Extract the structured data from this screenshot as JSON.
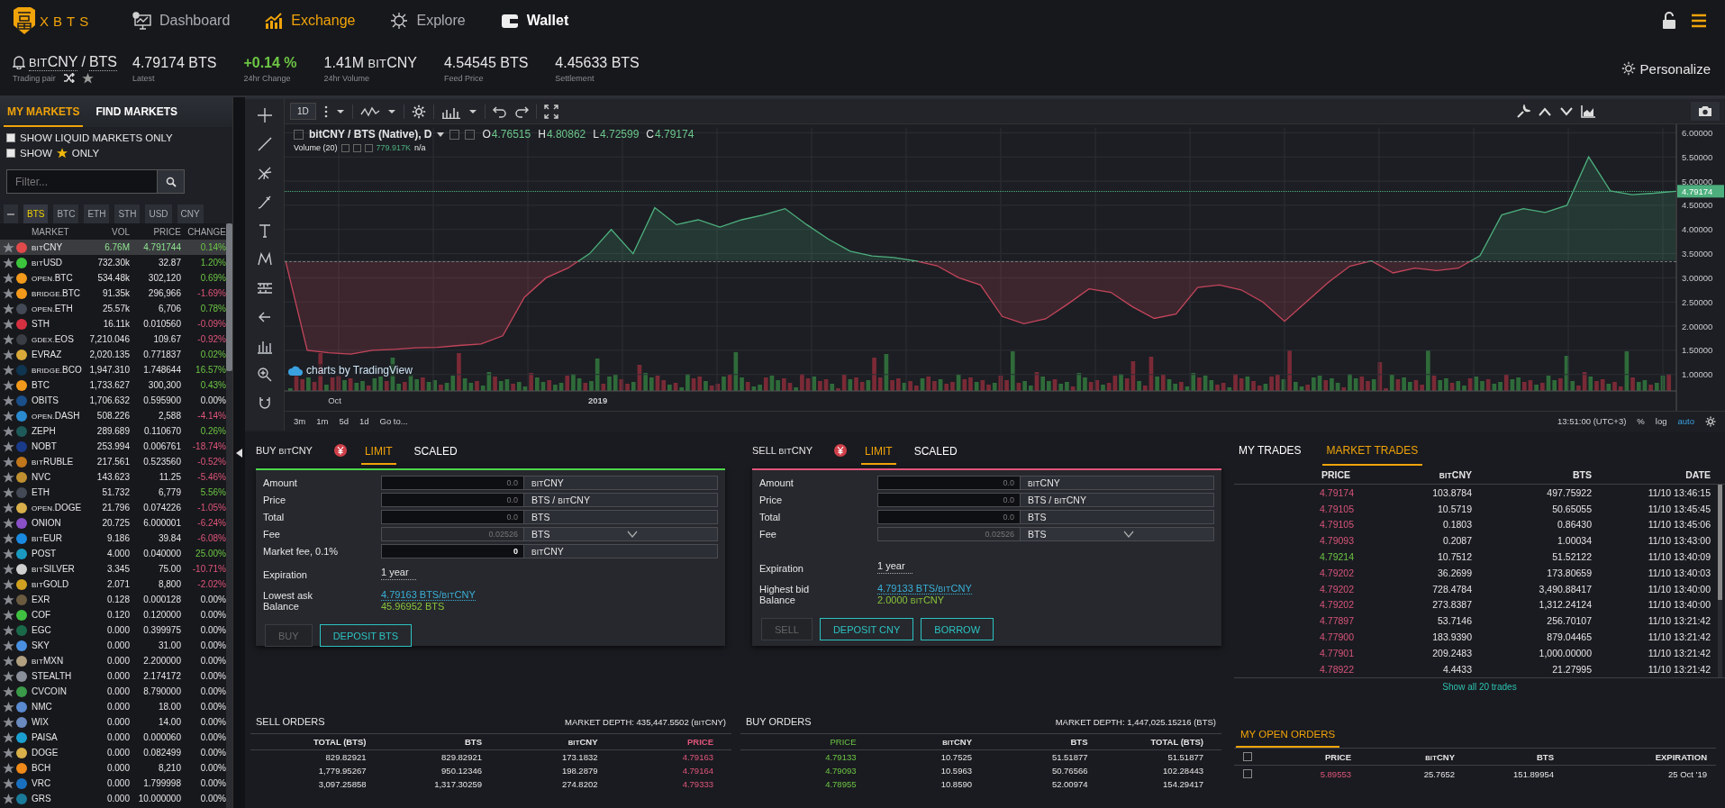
{
  "nav": {
    "logo": "XBTS",
    "items": [
      {
        "label": "Dashboard",
        "selected": false,
        "highlighted": false
      },
      {
        "label": "Exchange",
        "selected": true,
        "highlighted": false
      },
      {
        "label": "Explore",
        "selected": false,
        "highlighted": false
      },
      {
        "label": "Wallet",
        "selected": false,
        "highlighted": true
      }
    ]
  },
  "ticker": {
    "base": {
      "prefix": "BIT",
      "text": "CNY"
    },
    "separator": "/",
    "quote": "BTS",
    "label": "Trading pair",
    "stats": [
      {
        "value": {
          "text": "4.79174 BTS"
        },
        "label": "Latest",
        "up": false,
        "down": false
      },
      {
        "value": {
          "text": "+0.14 %"
        },
        "label": "24hr Change",
        "up": true,
        "down": false
      },
      {
        "value": {
          "lead": "1.41M ",
          "prefix": "BIT",
          "text": "CNY"
        },
        "label": "24hr Volume",
        "up": false,
        "down": false
      },
      {
        "value": {
          "text": "4.54545 BTS"
        },
        "label": "Feed Price",
        "up": false,
        "down": false
      },
      {
        "value": {
          "text": "4.45633 BTS"
        },
        "label": "Settlement",
        "up": false,
        "down": false
      }
    ],
    "personalize": "Personalize"
  },
  "sidebar": {
    "tabs": [
      {
        "label": "MY MARKETS",
        "selected": true
      },
      {
        "label": "FIND MARKETS",
        "selected": false
      }
    ],
    "options": [
      {
        "before": "SHOW LIQUID MARKETS ONLY",
        "checked": false
      },
      {
        "before": "SHOW",
        "after": "ONLY",
        "checked": false
      }
    ],
    "filter": {
      "placeholder": "Filter..."
    },
    "bases": [
      {
        "label": "BTS",
        "selected": true
      },
      {
        "label": "BTC",
        "selected": false
      },
      {
        "label": "ETH",
        "selected": false
      },
      {
        "label": "STH",
        "selected": false
      },
      {
        "label": "USD",
        "selected": false
      },
      {
        "label": "CNY",
        "selected": false
      }
    ],
    "columns": [
      "MARKET",
      "VOL",
      "PRICE",
      "CHANGE"
    ],
    "markets": [
      {
        "prefix": "BIT",
        "name": "CNY",
        "vol": "6.76M",
        "price": "4.791744",
        "change": "0.14%",
        "up": true,
        "down": false,
        "color": "#e04a4a",
        "selected": true
      },
      {
        "prefix": "BIT",
        "name": "USD",
        "vol": "732.30k",
        "price": "32.87",
        "change": "1.20%",
        "up": true,
        "down": false,
        "color": "#3cc43c",
        "selected": false
      },
      {
        "prefix": "OPEN.",
        "name": "BTC",
        "vol": "534.48k",
        "price": "302,120",
        "change": "0.69%",
        "up": true,
        "down": false,
        "color": "#f39a1c",
        "selected": false
      },
      {
        "prefix": "BRIDGE.",
        "name": "BTC",
        "vol": "91.35k",
        "price": "296,966",
        "change": "-1.69%",
        "up": false,
        "down": true,
        "color": "#f39a1c",
        "selected": false
      },
      {
        "prefix": "OPEN.",
        "name": "ETH",
        "vol": "25.57k",
        "price": "6,706",
        "change": "0.78%",
        "up": true,
        "down": false,
        "color": "#444a55",
        "selected": false
      },
      {
        "name": "STH",
        "vol": "16.11k",
        "price": "0.010560",
        "change": "-0.09%",
        "up": false,
        "down": true,
        "color": "#d43040",
        "selected": false
      },
      {
        "prefix": "GDEX.",
        "name": "EOS",
        "vol": "7,210.046",
        "price": "109.67",
        "change": "-0.92%",
        "up": false,
        "down": true,
        "color": "#3a3d44",
        "selected": false
      },
      {
        "name": "EVRAZ",
        "vol": "2,020.135",
        "price": "0.771837",
        "change": "0.02%",
        "up": true,
        "down": false,
        "color": "#d9a93a",
        "selected": false
      },
      {
        "prefix": "BRIDGE.",
        "name": "BCO",
        "vol": "1,947.310",
        "price": "1.748644",
        "change": "16.57%",
        "up": true,
        "down": false,
        "color": "#0f3550",
        "selected": false
      },
      {
        "name": "BTC",
        "vol": "1,733.627",
        "price": "300,300",
        "change": "0.43%",
        "up": true,
        "down": false,
        "color": "#f39a1c",
        "selected": false
      },
      {
        "name": "OBITS",
        "vol": "1,706.632",
        "price": "0.595900",
        "change": "0.00%",
        "up": false,
        "down": false,
        "color": "#1a4f8a",
        "selected": false
      },
      {
        "prefix": "OPEN.",
        "name": "DASH",
        "vol": "508.226",
        "price": "2,588",
        "change": "-4.14%",
        "up": false,
        "down": true,
        "color": "#2a8ad0",
        "selected": false
      },
      {
        "name": "ZEPH",
        "vol": "289.689",
        "price": "0.110670",
        "change": "0.26%",
        "up": true,
        "down": false,
        "color": "#1e5a5a",
        "selected": false
      },
      {
        "name": "NOBT",
        "vol": "253.994",
        "price": "0.006761",
        "change": "-18.74%",
        "up": false,
        "down": true,
        "color": "#1a3a8a",
        "selected": false
      },
      {
        "prefix": "BIT",
        "name": "RUBLE",
        "vol": "217.561",
        "price": "0.523560",
        "change": "-0.52%",
        "up": false,
        "down": true,
        "color": "#c0761a",
        "selected": false
      },
      {
        "name": "NVC",
        "vol": "143.623",
        "price": "11.25",
        "change": "-5.46%",
        "up": false,
        "down": true,
        "color": "#c09030",
        "selected": false
      },
      {
        "name": "ETH",
        "vol": "51.732",
        "price": "6,779",
        "change": "5.56%",
        "up": true,
        "down": false,
        "color": "#444a55",
        "selected": false
      },
      {
        "prefix": "OPEN.",
        "name": "DOGE",
        "vol": "21.796",
        "price": "0.074226",
        "change": "-1.05%",
        "up": false,
        "down": true,
        "color": "#d9b04a",
        "selected": false
      },
      {
        "name": "ONION",
        "vol": "20.725",
        "price": "6.000001",
        "change": "-6.24%",
        "up": false,
        "down": true,
        "color": "#8a50c8",
        "selected": false
      },
      {
        "prefix": "BIT",
        "name": "EUR",
        "vol": "9.186",
        "price": "39.84",
        "change": "-6.08%",
        "up": false,
        "down": true,
        "color": "#1a8ae0",
        "selected": false
      },
      {
        "name": "POST",
        "vol": "4.000",
        "price": "0.040000",
        "change": "25.00%",
        "up": true,
        "down": false,
        "color": "#1a9ac0",
        "selected": false
      },
      {
        "prefix": "BIT",
        "name": "SILVER",
        "vol": "3.345",
        "price": "75.00",
        "change": "-10.71%",
        "up": false,
        "down": true,
        "color": "#d0d0d0",
        "selected": false
      },
      {
        "prefix": "BIT",
        "name": "GOLD",
        "vol": "2.071",
        "price": "8,800",
        "change": "-2.02%",
        "up": false,
        "down": true,
        "color": "#d0a020",
        "selected": false
      },
      {
        "name": "EXR",
        "vol": "0.128",
        "price": "0.000128",
        "change": "0.00%",
        "up": false,
        "down": false,
        "color": "#6a5a40",
        "selected": false
      },
      {
        "name": "COF",
        "vol": "0.120",
        "price": "0.120000",
        "change": "0.00%",
        "up": false,
        "down": false,
        "color": "#40c040",
        "selected": false
      },
      {
        "name": "EGC",
        "vol": "0.000",
        "price": "0.399975",
        "change": "0.00%",
        "up": false,
        "down": false,
        "color": "#1a6a4a",
        "selected": false
      },
      {
        "name": "SKY",
        "vol": "0.000",
        "price": "31.00",
        "change": "0.00%",
        "up": false,
        "down": false,
        "color": "#4a90e0",
        "selected": false
      },
      {
        "prefix": "BIT",
        "name": "MXN",
        "vol": "0.000",
        "price": "2.200000",
        "change": "0.00%",
        "up": false,
        "down": false,
        "color": "#b0a080",
        "selected": false
      },
      {
        "name": "STEALTH",
        "vol": "0.000",
        "price": "2.174172",
        "change": "0.00%",
        "up": false,
        "down": false,
        "color": "#8a8f9a",
        "selected": false
      },
      {
        "name": "CVCOIN",
        "vol": "0.000",
        "price": "8.790000",
        "change": "0.00%",
        "up": false,
        "down": false,
        "color": "#3a9a4a",
        "selected": false
      },
      {
        "name": "NMC",
        "vol": "0.000",
        "price": "18.00",
        "change": "0.00%",
        "up": false,
        "down": false,
        "color": "#5a8ad0",
        "selected": false
      },
      {
        "name": "WIX",
        "vol": "0.000",
        "price": "14.00",
        "change": "0.00%",
        "up": false,
        "down": false,
        "color": "#6a8ac0",
        "selected": false
      },
      {
        "name": "PAISA",
        "vol": "0.000",
        "price": "0.000060",
        "change": "0.00%",
        "up": false,
        "down": false,
        "color": "#1aa0d0",
        "selected": false
      },
      {
        "name": "DOGE",
        "vol": "0.000",
        "price": "0.082499",
        "change": "0.00%",
        "up": false,
        "down": false,
        "color": "#d9b04a",
        "selected": false
      },
      {
        "name": "BCH",
        "vol": "0.000",
        "price": "8,210",
        "change": "0.00%",
        "up": false,
        "down": false,
        "color": "#f08a1a",
        "selected": false
      },
      {
        "name": "VRC",
        "vol": "0.000",
        "price": "1.799998",
        "change": "0.00%",
        "up": false,
        "down": false,
        "color": "#1a70c0",
        "selected": false
      },
      {
        "name": "GRS",
        "vol": "0.000",
        "price": "10.000000",
        "change": "0.00%",
        "up": false,
        "down": false,
        "color": "#1a7a9a",
        "selected": false
      }
    ]
  },
  "chart": {
    "interval": "1D",
    "title_suffix": " (Native), D",
    "time_labels": [
      "Oct",
      "2019"
    ],
    "ohlc": [
      {
        "key": "O",
        "value": "4.76515"
      },
      {
        "key": "H",
        "value": "4.80862"
      },
      {
        "key": "L",
        "value": "4.72599"
      },
      {
        "key": "C",
        "value": "4.79174"
      }
    ],
    "volume_label": "Volume (20)",
    "volume_value": "779.917K",
    "volume_extra": "n/a",
    "credit": "charts by TradingView",
    "ranges": [
      "3m",
      "1m",
      "5d",
      "1d"
    ],
    "goto": "Go to...",
    "time": "13:51:00 (UTC+3)",
    "scale_options": [
      {
        "label": "%",
        "selected": false
      },
      {
        "label": "log",
        "selected": false
      },
      {
        "label": "auto",
        "selected": true
      }
    ],
    "chart_data": {
      "type": "area",
      "grid": true,
      "ylim": [
        0.66,
        6.1
      ],
      "series": [
        {
          "name": "bitCNY / BTS",
          "color": "#4caf7d",
          "values": [
            3.35,
            1.5,
            1.45,
            1.42,
            1.5,
            1.52,
            1.55,
            1.56,
            1.6,
            1.63,
            1.8,
            2.6,
            3.0,
            3.2,
            3.5,
            4.0,
            3.5,
            4.45,
            4.1,
            4.2,
            4.05,
            4.2,
            4.3,
            4.43,
            4.1,
            3.8,
            3.55,
            3.45,
            3.42,
            3.35,
            3.25,
            3.0,
            2.85,
            2.2,
            2.05,
            2.15,
            2.45,
            2.77,
            2.7,
            2.4,
            2.16,
            2.25,
            2.8,
            2.85,
            2.75,
            2.5,
            2.1,
            2.5,
            2.9,
            3.24,
            3.35,
            3.1,
            3.2,
            3.15,
            3.2,
            3.46,
            4.3,
            4.43,
            4.35,
            4.5,
            5.5,
            4.8,
            4.72,
            4.75,
            4.79
          ]
        }
      ],
      "yticks": [
        {
          "value": 1,
          "label": "1.00000"
        },
        {
          "value": 1.5,
          "label": "1.50000"
        },
        {
          "value": 2,
          "label": "2.00000"
        },
        {
          "value": 2.5,
          "label": "2.50000"
        },
        {
          "value": 3,
          "label": "3.00000"
        },
        {
          "value": 3.5,
          "label": "3.50000"
        },
        {
          "value": 4,
          "label": "4.00000"
        },
        {
          "value": 4.5,
          "label": "4.50000"
        },
        {
          "value": 5,
          "label": "5.00000"
        },
        {
          "value": 5.5,
          "label": "5.50000"
        },
        {
          "value": 6,
          "label": "6.00000"
        }
      ],
      "annotations": [
        "4.79174"
      ]
    }
  },
  "forms": [
    {
      "kind": "buy",
      "title": {
        "lead": "BUY ",
        "prefix": "BIT",
        "text": "CNY"
      },
      "tabs": [
        {
          "label": "LIMIT",
          "selected": true
        },
        {
          "label": "SCALED",
          "selected": false
        }
      ],
      "fields": [
        {
          "label": "Amount",
          "placeholder": "0.0",
          "unit": {
            "prefix": "BIT",
            "text": "CNY"
          },
          "disabled": false,
          "dropdown": false
        },
        {
          "label": "Price",
          "placeholder": "0.0",
          "unit": {
            "lead": "BTS / ",
            "prefix": "BIT",
            "text": "CNY"
          },
          "disabled": false,
          "dropdown": false
        },
        {
          "label": "Total",
          "placeholder": "0.0",
          "unit": {
            "text": "BTS"
          },
          "disabled": false,
          "dropdown": false
        },
        {
          "label": "Fee",
          "value": "0.02526",
          "unit": {
            "text": "BTS"
          },
          "disabled": true,
          "dropdown": true
        },
        {
          "label": "Market fee, 0.1%",
          "value": "0",
          "unit": {
            "prefix": "BIT",
            "text": "CNY"
          },
          "disabled": false,
          "dropdown": false
        }
      ],
      "info": [
        {
          "kind": "select",
          "label": "Expiration",
          "value": {
            "text": "1 year"
          }
        },
        {
          "kind": "link",
          "label": "Lowest ask",
          "value": {
            "lead": "4.79163 BTS/",
            "prefix": "BIT",
            "text": "CNY"
          }
        },
        {
          "kind": "balance",
          "label": "Balance",
          "value": {
            "text": "45.96952 BTS"
          }
        }
      ],
      "buttons": [
        {
          "label": "BUY",
          "disabled": true
        },
        {
          "label": "DEPOSIT BTS",
          "disabled": false
        }
      ]
    },
    {
      "kind": "sell",
      "title": {
        "lead": "SELL ",
        "prefix": "BIT",
        "text": "CNY"
      },
      "tabs": [
        {
          "label": "LIMIT",
          "selected": true
        },
        {
          "label": "SCALED",
          "selected": false
        }
      ],
      "fields": [
        {
          "label": "Amount",
          "placeholder": "0.0",
          "unit": {
            "prefix": "BIT",
            "text": "CNY"
          },
          "disabled": false,
          "dropdown": false
        },
        {
          "label": "Price",
          "placeholder": "0.0",
          "unit": {
            "lead": "BTS / ",
            "prefix": "BIT",
            "text": "CNY"
          },
          "disabled": false,
          "dropdown": false
        },
        {
          "label": "Total",
          "placeholder": "0.0",
          "unit": {
            "text": "BTS"
          },
          "disabled": false,
          "dropdown": false
        },
        {
          "label": "Fee",
          "value": "0.02526",
          "unit": {
            "text": "BTS"
          },
          "disabled": true,
          "dropdown": true
        }
      ],
      "info": [
        {
          "kind": "select",
          "label": "Expiration",
          "value": {
            "text": "1 year"
          }
        },
        {
          "kind": "link",
          "label": "Highest bid",
          "value": {
            "lead": "4.79133 BTS/",
            "prefix": "BIT",
            "text": "CNY"
          }
        },
        {
          "kind": "balance",
          "label": "Balance",
          "value": {
            "lead": "2.0000 ",
            "prefix": "BIT",
            "text": "CNY"
          }
        }
      ],
      "buttons": [
        {
          "label": "SELL",
          "disabled": true
        },
        {
          "label": "DEPOSIT CNY",
          "disabled": false
        },
        {
          "label": "BORROW",
          "disabled": false
        }
      ]
    }
  ],
  "trades": {
    "tabs": [
      {
        "label": "MY TRADES",
        "selected": false
      },
      {
        "label": "MARKET TRADES",
        "selected": true
      }
    ],
    "columns": [
      {
        "text": "PRICE"
      },
      {
        "prefix": "BIT",
        "text": "CNY"
      },
      {
        "text": "BTS"
      },
      {
        "text": "DATE"
      }
    ],
    "rows": [
      {
        "kind": "sell",
        "cells": [
          "4.79174",
          "103.8784",
          "497.75922",
          "11/10 13:46:15"
        ]
      },
      {
        "kind": "sell",
        "cells": [
          "4.79105",
          "10.5719",
          "50.65055",
          "11/10 13:45:45"
        ]
      },
      {
        "kind": "sell",
        "cells": [
          "4.79105",
          "0.1803",
          "0.86430",
          "11/10 13:45:06"
        ]
      },
      {
        "kind": "sell",
        "cells": [
          "4.79093",
          "0.2087",
          "1.00034",
          "11/10 13:43:00"
        ]
      },
      {
        "kind": "buy",
        "cells": [
          "4.79214",
          "10.7512",
          "51.52122",
          "11/10 13:40:09"
        ]
      },
      {
        "kind": "sell",
        "cells": [
          "4.79202",
          "36.2699",
          "173.80659",
          "11/10 13:40:03"
        ]
      },
      {
        "kind": "sell",
        "cells": [
          "4.79202",
          "728.4784",
          "3,490.88417",
          "11/10 13:40:00"
        ]
      },
      {
        "kind": "sell",
        "cells": [
          "4.79202",
          "273.8387",
          "1,312.24124",
          "11/10 13:40:00"
        ]
      },
      {
        "kind": "sell",
        "cells": [
          "4.77897",
          "53.7146",
          "256.70107",
          "11/10 13:21:42"
        ]
      },
      {
        "kind": "sell",
        "cells": [
          "4.77900",
          "183.9390",
          "879.04465",
          "11/10 13:21:42"
        ]
      },
      {
        "kind": "sell",
        "cells": [
          "4.77901",
          "209.2483",
          "1,000.00000",
          "11/10 13:21:42"
        ]
      },
      {
        "kind": "sell",
        "cells": [
          "4.78922",
          "4.4433",
          "21.27995",
          "11/10 13:21:42"
        ]
      }
    ],
    "footer": "Show all 20 trades"
  },
  "orders": [
    {
      "kind": "sell",
      "title": "SELL ORDERS",
      "depth": {
        "lead": "MARKET DEPTH: 435,447.5502 (",
        "prefix": "BIT",
        "text": "CNY",
        "tail": ")"
      },
      "columns": [
        {
          "text": "TOTAL (BTS)"
        },
        {
          "text": "BTS"
        },
        {
          "prefix": "BIT",
          "text": "CNY"
        },
        {
          "text": "PRICE"
        }
      ],
      "rows": [
        [
          "829.82921",
          "829.82921",
          "173.1832",
          "4.79163"
        ],
        [
          "1,779.95267",
          "950.12346",
          "198.2879",
          "4.79164"
        ],
        [
          "3,097.25858",
          "1,317.30259",
          "274.8202",
          "4.79333"
        ]
      ]
    },
    {
      "kind": "buy",
      "title": "BUY ORDERS",
      "depth": {
        "text": "MARKET DEPTH: 1,447,025.15216 (BTS)"
      },
      "columns": [
        {
          "text": "PRICE"
        },
        {
          "prefix": "BIT",
          "text": "CNY"
        },
        {
          "text": "BTS"
        },
        {
          "text": "TOTAL (BTS)"
        }
      ],
      "rows": [
        [
          "4.79133",
          "10.7525",
          "51.51877",
          "51.51877"
        ],
        [
          "4.79093",
          "10.5963",
          "50.76566",
          "102.28443"
        ],
        [
          "4.78955",
          "10.8590",
          "52.00974",
          "154.29417"
        ]
      ]
    }
  ],
  "open_orders": {
    "tab": {
      "label": "MY OPEN ORDERS",
      "selected": true
    },
    "all_checked": false,
    "columns": [
      {
        "text": "PRICE"
      },
      {
        "prefix": "BIT",
        "text": "CNY"
      },
      {
        "text": "BTS"
      },
      {
        "text": "EXPIRATION"
      }
    ],
    "rows": [
      {
        "checked": false,
        "kind": "sell",
        "cells": [
          "5.89553",
          "25.7652",
          "151.89954",
          "25 Oct '19"
        ]
      }
    ]
  }
}
